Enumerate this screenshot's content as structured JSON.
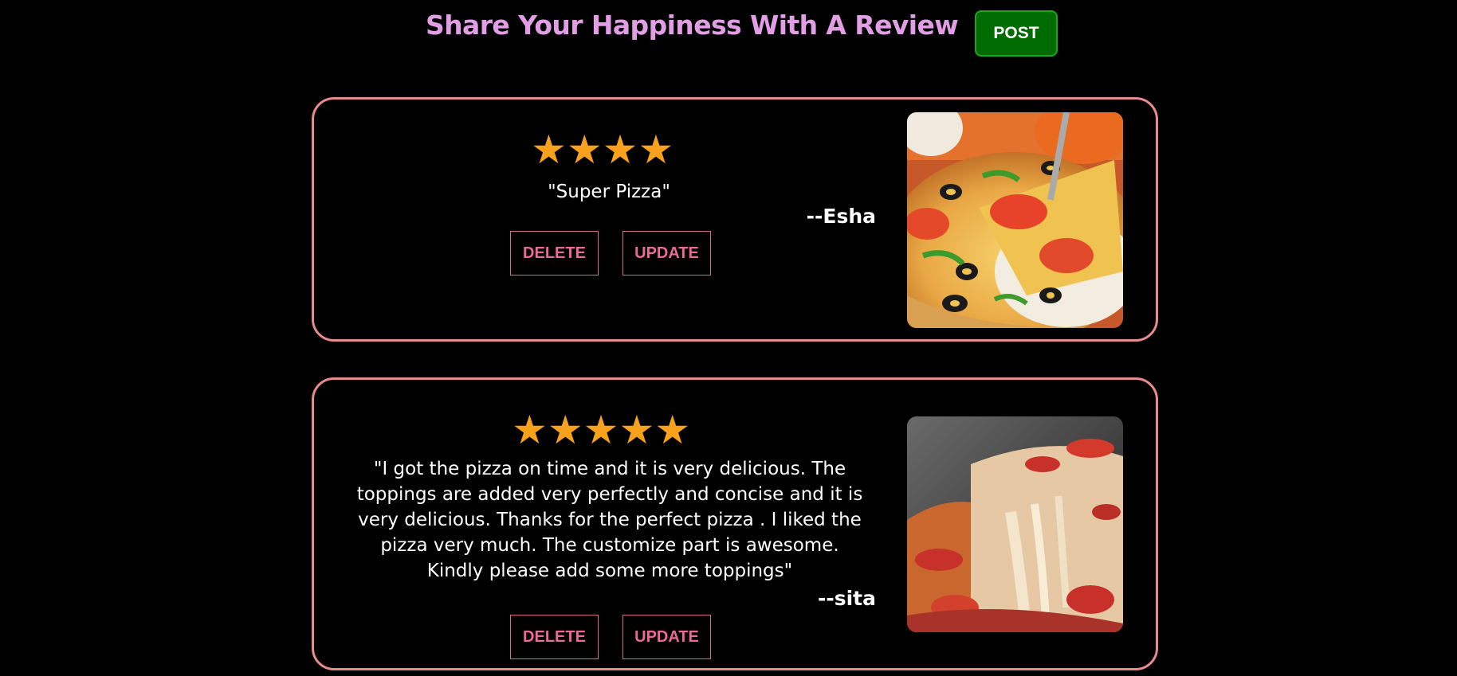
{
  "header": {
    "title": "Share Your Happiness With A Review",
    "post_label": "POST"
  },
  "colors": {
    "background": "#000000",
    "title": "#e29ee4",
    "post_button_bg": "#006b00",
    "card_border": "#e88b8d",
    "star": "#f7a11d",
    "action_text": "#ea6c95"
  },
  "reviews": [
    {
      "rating": 4,
      "stars": "★★★★",
      "text": "\"Super Pizza\"",
      "author": "--Esha",
      "delete_label": "DELETE",
      "update_label": "UPDATE",
      "image": "pizza-slice-photo"
    },
    {
      "rating": 5,
      "stars": "★★★★★",
      "text": "\"I got the pizza on time and it is very delicious. The toppings are added very perfectly and concise and it is very delicious. Thanks for the perfect pizza . I liked the pizza very much. The customize part is awesome. Kindly please add some more toppings\"",
      "author": "--sita",
      "delete_label": "DELETE",
      "update_label": "UPDATE",
      "image": "cheesy-pizza-photo"
    }
  ]
}
